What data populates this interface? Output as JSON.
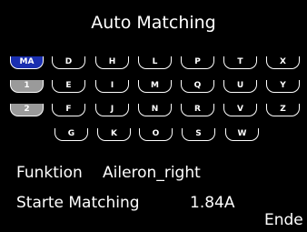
{
  "title": "Auto Matching",
  "keys": {
    "MA": "MA",
    "one": "1",
    "two": "2",
    "D": "D",
    "E": "E",
    "F": "F",
    "G": "G",
    "H": "H",
    "I": "I",
    "J": "J",
    "K": "K",
    "L": "L",
    "M": "M",
    "N": "N",
    "O": "O",
    "P": "P",
    "Q": "Q",
    "R": "R",
    "S": "S",
    "T": "T",
    "U": "U",
    "V": "V",
    "W": "W",
    "X": "X",
    "Y": "Y",
    "Z": "Z"
  },
  "function_label": "Funktion",
  "function_value": "Aileron_right",
  "start_label": "Starte Matching",
  "current_value": "1.84A",
  "end_label": "Ende",
  "colors": {
    "selected": "#1a2fb0",
    "grey_key": "#9a9a9a",
    "background": "#000000"
  }
}
